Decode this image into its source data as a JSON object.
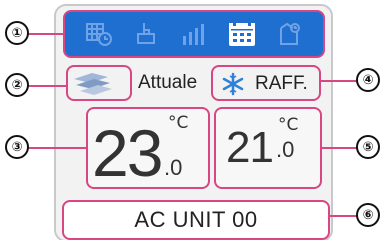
{
  "callouts": [
    "①",
    "②",
    "③",
    "④",
    "⑤",
    "⑥"
  ],
  "toolbar": {
    "icons": [
      "grid-clock-icon",
      "hand-touch-icon",
      "fan-speed-icon",
      "calendar-icon",
      "hand-clock-icon"
    ],
    "active_index": 3
  },
  "mode": {
    "icon": "airflow-swing-icon",
    "current_label": "Attuale",
    "operation_icon": "snowflake-icon",
    "operation_label": "RAFF."
  },
  "temperature": {
    "current_integer": "23",
    "current_decimal": ".0",
    "current_unit": "°C",
    "set_integer": "21",
    "set_decimal": ".0",
    "set_unit": "°C"
  },
  "unit": {
    "name": "AC UNIT 00"
  },
  "colors": {
    "toolbar_blue": "#1e6fd0",
    "highlight_pink": "#d64784",
    "snow_blue": "#2f80d8"
  }
}
